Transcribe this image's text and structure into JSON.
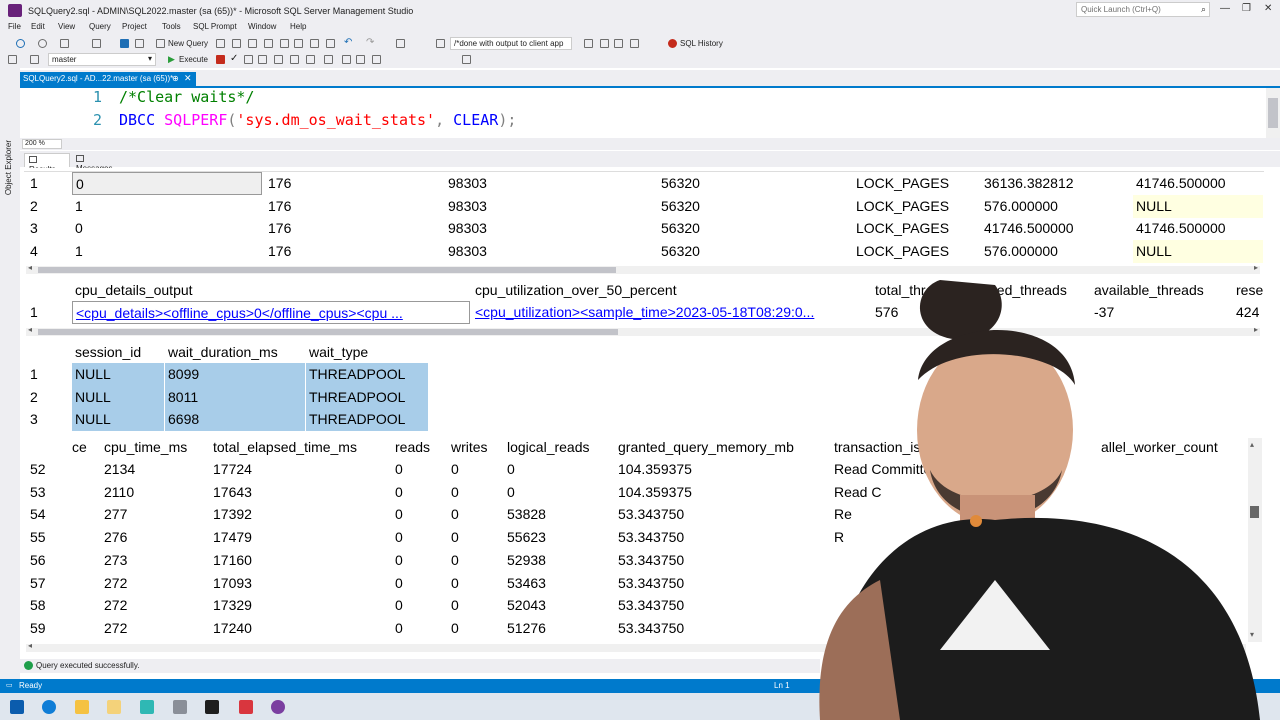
{
  "window": {
    "title": "SQLQuery2.sql - ADMIN\\SQL2022.master (sa (65))* - Microsoft SQL Server Management Studio",
    "quick_launch_placeholder": "Quick Launch (Ctrl+Q)"
  },
  "menu": [
    "File",
    "Edit",
    "View",
    "Query",
    "Project",
    "Tools",
    "SQL Prompt",
    "Window",
    "Help"
  ],
  "toolbar": {
    "new_query": "New Query",
    "run_config": "/*done with output to client app",
    "sql_history": "SQL History",
    "database": "master",
    "execute": "Execute"
  },
  "side_panel": {
    "label": "Object Explorer"
  },
  "document_tab": {
    "label": "SQLQuery2.sql - AD...22.master (sa (65))*",
    "pin": "⊕",
    "close": "✕"
  },
  "editor": {
    "lines": [
      {
        "number": "1",
        "comment": "/*Clear waits*/"
      },
      {
        "number": "2",
        "keyword": "DBCC",
        "function": "SQLPERF",
        "open": "(",
        "string": "'sys.dm_os_wait_stats'",
        "comma": ",",
        "arg": " CLEAR",
        "close": ");"
      }
    ]
  },
  "zoom": "200 %",
  "results_tabs": {
    "results": "Results",
    "messages": "Messages"
  },
  "grid1": {
    "rows": [
      {
        "n": "1",
        "c": [
          "0",
          "176",
          "98303",
          "56320",
          "LOCK_PAGES",
          "36136.382812",
          "41746.500000"
        ]
      },
      {
        "n": "2",
        "c": [
          "1",
          "176",
          "98303",
          "56320",
          "LOCK_PAGES",
          "576.000000",
          "NULL"
        ]
      },
      {
        "n": "3",
        "c": [
          "0",
          "176",
          "98303",
          "56320",
          "LOCK_PAGES",
          "41746.500000",
          "41746.500000"
        ]
      },
      {
        "n": "4",
        "c": [
          "1",
          "176",
          "98303",
          "56320",
          "LOCK_PAGES",
          "576.000000",
          "NULL"
        ]
      }
    ]
  },
  "grid2": {
    "headers": [
      "cpu_details_output",
      "cpu_utilization_over_50_percent",
      "total_threads",
      "used_threads",
      "available_threads",
      "rese"
    ],
    "rows": [
      {
        "n": "1",
        "c": [
          "<cpu_details><offline_cpus>0</offline_cpus><cpu ...",
          "<cpu_utilization><sample_time>2023-05-18T08:29:0...",
          "576",
          "",
          "-37",
          "424"
        ]
      }
    ]
  },
  "grid3": {
    "headers": [
      "session_id",
      "wait_duration_ms",
      "wait_type"
    ],
    "rows": [
      {
        "n": "1",
        "c": [
          "NULL",
          "8099",
          "THREADPOOL"
        ]
      },
      {
        "n": "2",
        "c": [
          "NULL",
          "8011",
          "THREADPOOL"
        ]
      },
      {
        "n": "3",
        "c": [
          "NULL",
          "6698",
          "THREADPOOL"
        ]
      }
    ]
  },
  "grid4": {
    "headers": [
      "ce",
      "cpu_time_ms",
      "total_elapsed_time_ms",
      "reads",
      "writes",
      "logical_reads",
      "granted_query_memory_mb",
      "transaction_isola",
      "allel_worker_count"
    ],
    "rows": [
      {
        "n": "52",
        "c": [
          "2134",
          "17724",
          "0",
          "0",
          "0",
          "104.359375",
          "Read Committe"
        ]
      },
      {
        "n": "53",
        "c": [
          "2110",
          "17643",
          "0",
          "0",
          "0",
          "104.359375",
          "Read C"
        ]
      },
      {
        "n": "54",
        "c": [
          "277",
          "17392",
          "0",
          "0",
          "53828",
          "53.343750",
          "Re"
        ]
      },
      {
        "n": "55",
        "c": [
          "276",
          "17479",
          "0",
          "0",
          "55623",
          "53.343750",
          "R"
        ]
      },
      {
        "n": "56",
        "c": [
          "273",
          "17160",
          "0",
          "0",
          "52938",
          "53.343750",
          ""
        ]
      },
      {
        "n": "57",
        "c": [
          "272",
          "17093",
          "0",
          "0",
          "53463",
          "53.343750",
          ""
        ]
      },
      {
        "n": "58",
        "c": [
          "272",
          "17329",
          "0",
          "0",
          "52043",
          "53.343750",
          ""
        ]
      },
      {
        "n": "59",
        "c": [
          "272",
          "17240",
          "0",
          "0",
          "51276",
          "53.343750",
          ""
        ]
      }
    ]
  },
  "query_status": "Query executed successfully.",
  "status_bar": {
    "left": "Ready",
    "line": "Ln 1"
  },
  "colors": {
    "accent": "#007acc",
    "selection": "#a8cde9",
    "chrome": "#eeeef2"
  }
}
